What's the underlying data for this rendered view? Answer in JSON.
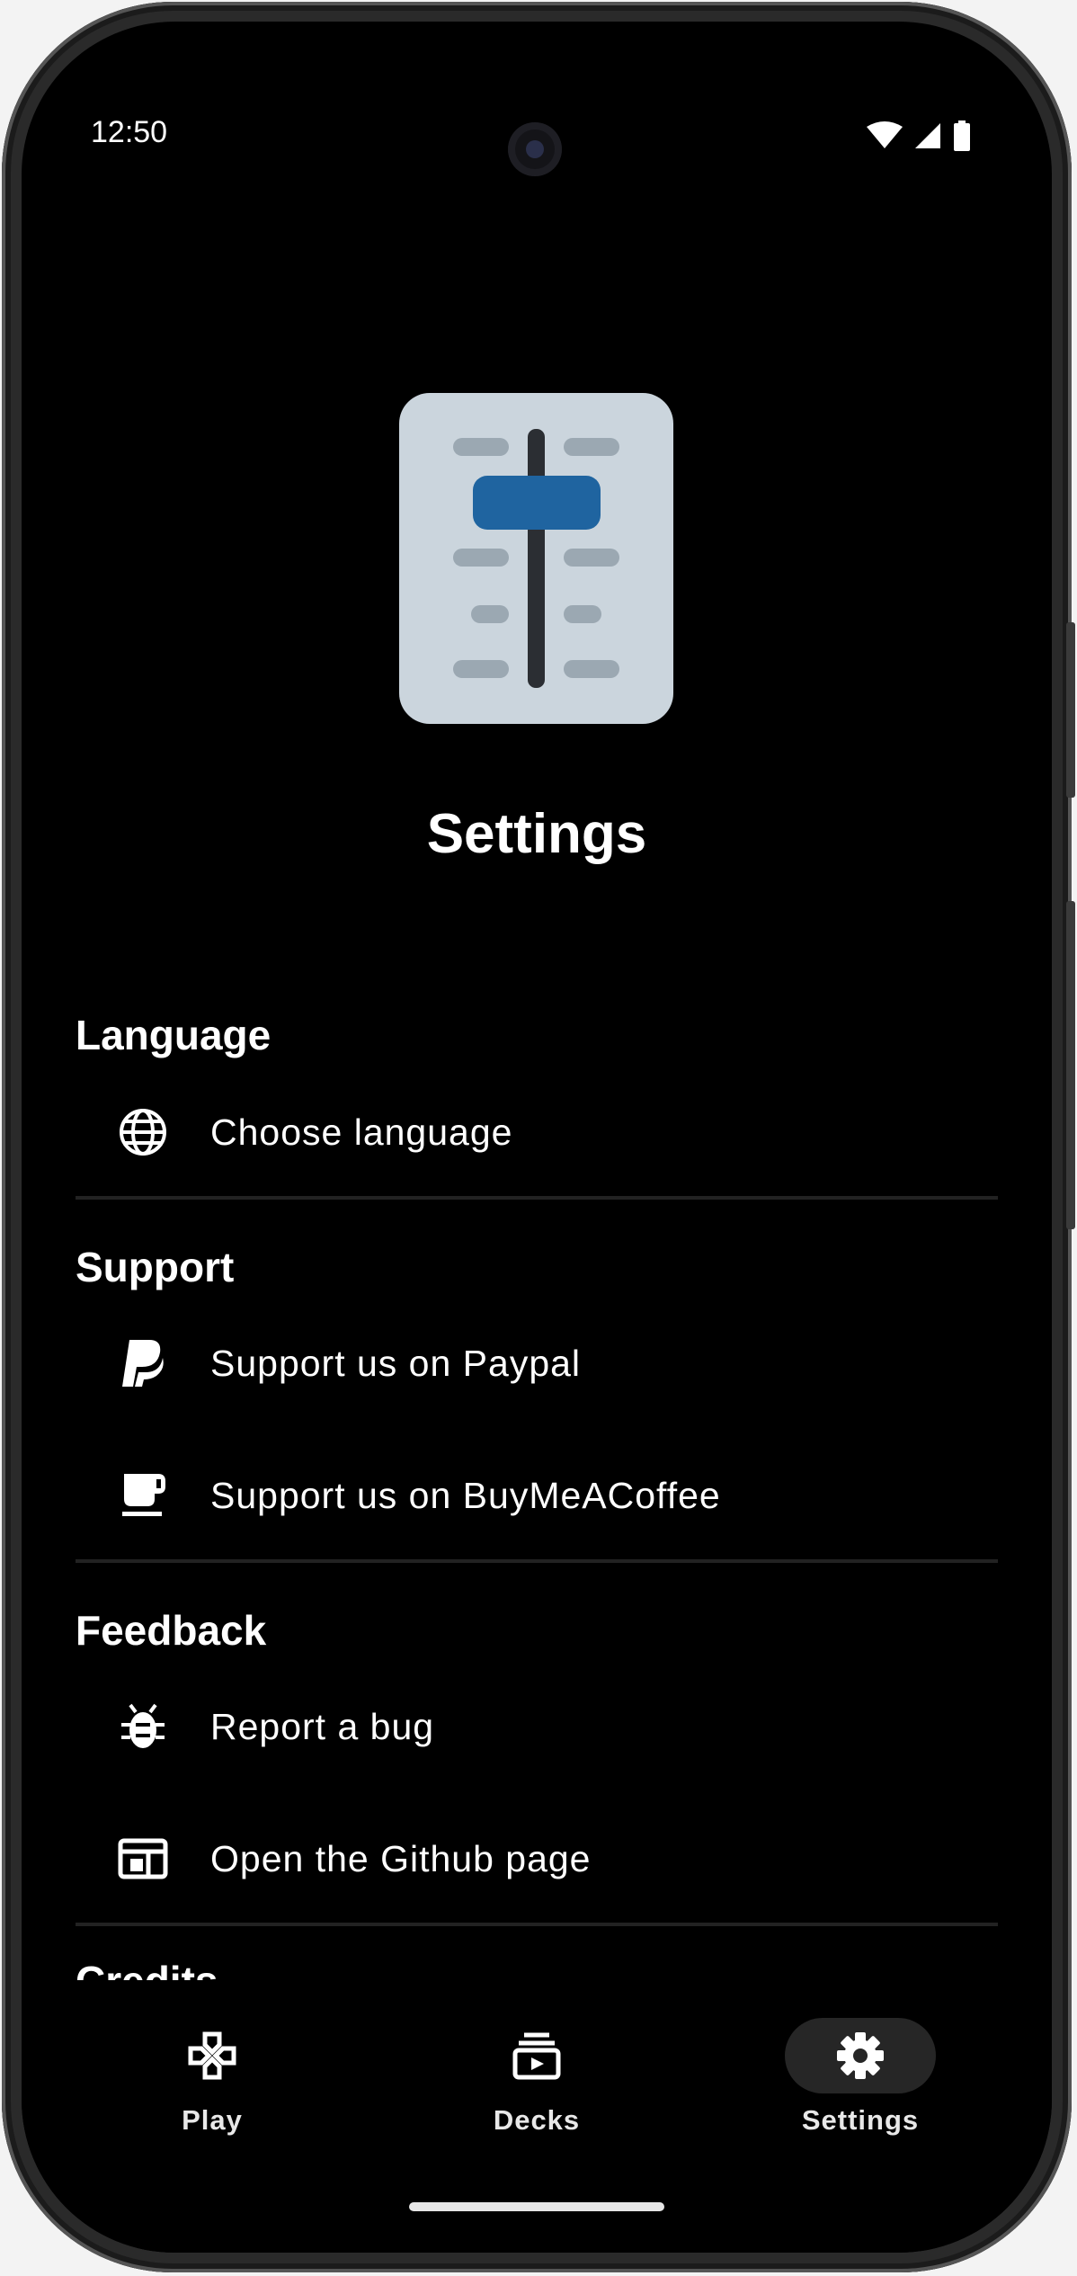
{
  "status_bar": {
    "time": "12:50"
  },
  "page": {
    "title": "Settings"
  },
  "sections": [
    {
      "title": "Language",
      "items": [
        {
          "label": "Choose language",
          "icon": "globe-icon"
        }
      ]
    },
    {
      "title": "Support",
      "items": [
        {
          "label": "Support us on Paypal",
          "icon": "paypal-icon"
        },
        {
          "label": "Support us on BuyMeACoffee",
          "icon": "coffee-icon"
        }
      ]
    },
    {
      "title": "Feedback",
      "items": [
        {
          "label": "Report a bug",
          "icon": "bug-icon"
        },
        {
          "label": "Open the Github page",
          "icon": "web-window-icon"
        }
      ]
    },
    {
      "title": "Credits"
    }
  ],
  "nav": [
    {
      "label": "Play",
      "icon": "gamepad-icon"
    },
    {
      "label": "Decks",
      "icon": "deck-icon"
    },
    {
      "label": "Settings",
      "icon": "gear-icon",
      "active": true
    }
  ],
  "colors": {
    "icon_bg": "#cbd5dd",
    "slider_knob": "#1f64a0",
    "slider_track": "#2b2e33",
    "tick": "#9ba8b2"
  }
}
